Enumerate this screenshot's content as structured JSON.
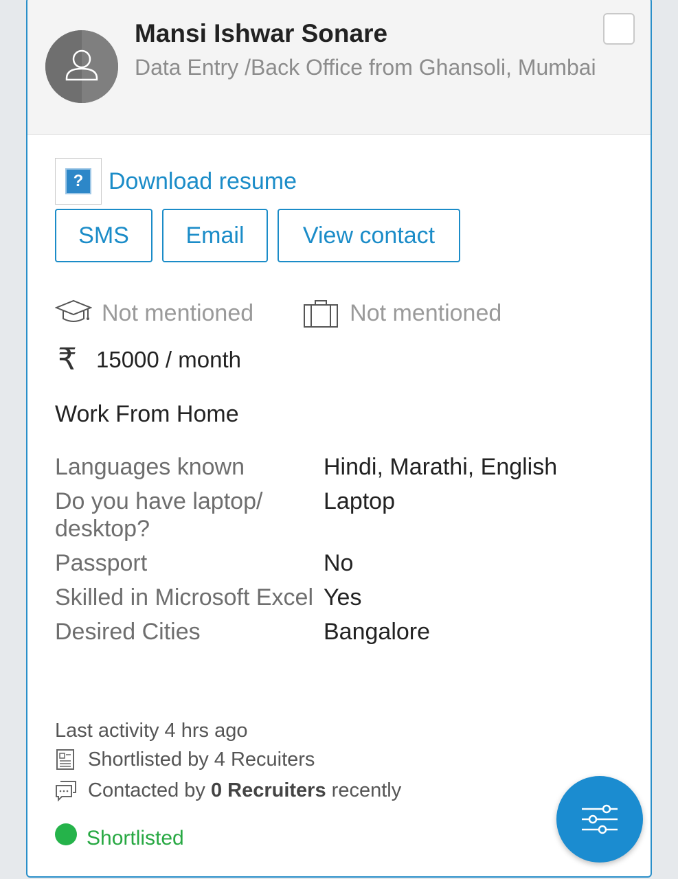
{
  "candidate": {
    "name": "Mansi Ishwar Sonare",
    "subtitle": "Data Entry /Back Office from Ghansoli, Mumbai"
  },
  "actions": {
    "download_label": "Download resume",
    "sms_label": "SMS",
    "email_label": "Email",
    "view_contact_label": "View contact"
  },
  "meta": {
    "education": "Not mentioned",
    "experience": "Not mentioned",
    "salary": "15000 / month",
    "rupee_symbol": "₹",
    "work_mode": "Work From Home"
  },
  "facts": [
    {
      "key": "Languages known",
      "value": "Hindi, Marathi, English"
    },
    {
      "key": "Do you have laptop/ desktop?",
      "value": "Laptop"
    },
    {
      "key": "Passport",
      "value": "No"
    },
    {
      "key": "Skilled in Microsoft Excel",
      "value": "Yes"
    },
    {
      "key": "Desired Cities",
      "value": "Bangalore"
    }
  ],
  "activity": {
    "last_activity": "Last activity 4 hrs ago",
    "shortlisted_by": "Shortlisted by 4 Recuiters",
    "contacted_prefix": "Contacted by",
    "contacted_count": "0 Recruiters",
    "contacted_suffix": "recently"
  },
  "status": {
    "label": "Shortlisted",
    "color": "#27a842"
  },
  "colors": {
    "accent": "#1b8cc8",
    "fab": "#1b8cd0"
  }
}
